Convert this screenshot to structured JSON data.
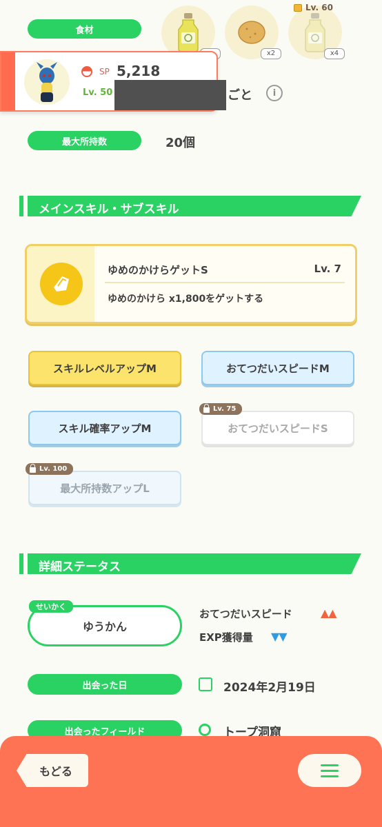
{
  "ingredients": {
    "label": "食材",
    "items": [
      {
        "icon": "oil-bottle-icon",
        "count": ""
      },
      {
        "icon": "potato-icon",
        "count": "x2"
      },
      {
        "icon": "oil-bottle-icon",
        "count": "x4",
        "lock_level": "Lv. 60"
      }
    ]
  },
  "pokemon_card": {
    "sp_label": "SP",
    "sp_value": "5,218",
    "level": "Lv. 50",
    "partial_text": "ごと"
  },
  "max_carry": {
    "label": "最大所持数",
    "value": "20個"
  },
  "skill_section": {
    "title": "メインスキル・サブスキル"
  },
  "main_skill": {
    "name": "ゆめのかけらゲットS",
    "level": "Lv. 7",
    "description": "ゆめのかけら x1,800をゲットする"
  },
  "sub_skills": [
    {
      "label": "スキルレベルアップM",
      "lock": ""
    },
    {
      "label": "おてつだいスピードM",
      "lock": ""
    },
    {
      "label": "スキル確率アップM",
      "lock": ""
    },
    {
      "label": "おてつだいスピードS",
      "lock": "Lv. 75"
    },
    {
      "label": "最大所持数アップL",
      "lock": "Lv. 100"
    }
  ],
  "detail_section": {
    "title": "詳細ステータス"
  },
  "nature": {
    "tag": "せいかく",
    "value": "ゆうかん",
    "up_stat": "おてつだいスピード",
    "up_marks": "▲▲",
    "down_stat": "EXP獲得量",
    "down_marks": "▼▼"
  },
  "met_date": {
    "label": "出会った日",
    "value": "2024年2月19日"
  },
  "met_field": {
    "label": "出会ったフィールド",
    "value": "トープ洞窟"
  },
  "footer": {
    "back_label": "もどる"
  },
  "colors": {
    "accent_green": "#2ad263",
    "footer_orange": "#ff7355",
    "up_arrow": "#f2643f",
    "down_arrow": "#2f9be5"
  }
}
